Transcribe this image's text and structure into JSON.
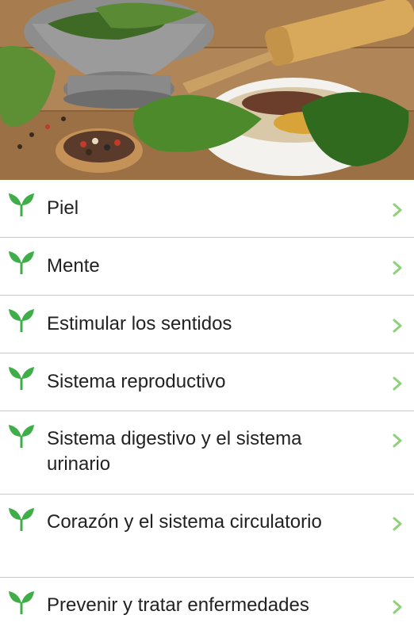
{
  "hero": {
    "image": "herbs-and-spices-photo"
  },
  "list": {
    "items": [
      {
        "label": "Piel"
      },
      {
        "label": "Mente"
      },
      {
        "label": "Estimular los sentidos"
      },
      {
        "label": "Sistema reproductivo"
      },
      {
        "label": "Sistema digestivo y el sistema urinario"
      },
      {
        "label": "Corazón y el sistema circulatorio"
      },
      {
        "label": "Prevenir y tratar enfermedades"
      }
    ],
    "item_icon": "sprout-leaf-icon",
    "chevron_icon": "chevron-right-icon"
  },
  "colors": {
    "accent_green": "#3fae49",
    "chevron_green": "#8fd07a",
    "divider": "#c9c9c9",
    "text": "#222222"
  }
}
